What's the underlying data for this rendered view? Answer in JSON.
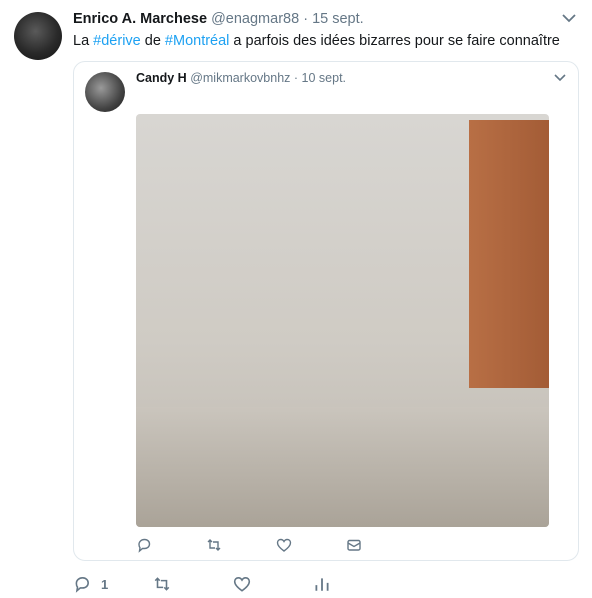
{
  "tweet": {
    "author_name": "Enrico A. Marchese",
    "author_handle": "@enagmar88",
    "separator": "·",
    "date": "15 sept.",
    "text": [
      {
        "t": "La ",
        "tag": false
      },
      {
        "t": "#dérive",
        "tag": true
      },
      {
        "t": " de ",
        "tag": false
      },
      {
        "t": "#Montréal",
        "tag": true
      },
      {
        "t": " a parfois des idées bizarres pour se faire connaître",
        "tag": false
      }
    ],
    "reply_count": "1"
  },
  "quoted": {
    "author_name": "Candy H",
    "author_handle": "@mikmarkovbnhz",
    "separator": "·",
    "date": "10 sept."
  },
  "colors": {
    "link": "#1da1f2",
    "secondary_text": "#657786",
    "border": "#e1e8ed"
  },
  "icons": {
    "tweet_actions": [
      "reply-icon",
      "retweet-icon",
      "like-icon",
      "analytics-icon"
    ],
    "quoted_actions": [
      "reply-icon",
      "retweet-icon",
      "like-icon",
      "message-icon"
    ]
  }
}
